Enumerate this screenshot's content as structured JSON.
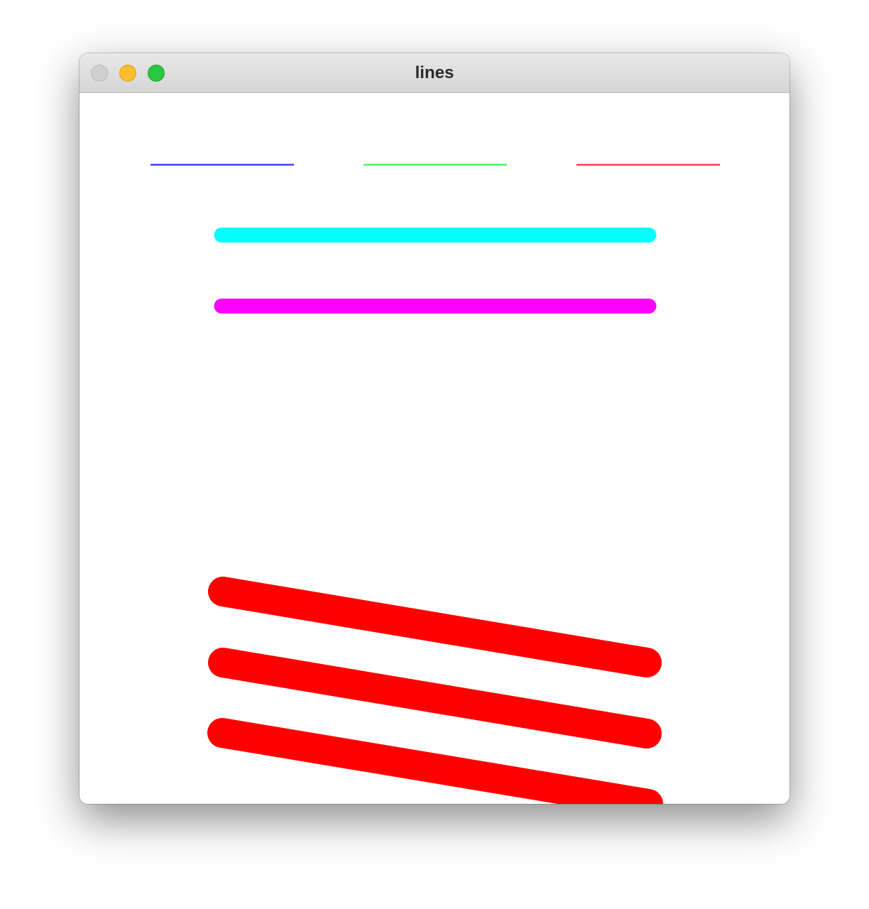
{
  "window": {
    "title": "lines"
  },
  "icons": {
    "close": "close-button",
    "minimize": "minimize-button",
    "zoom": "zoom-button"
  },
  "colors": {
    "close": "#d0d0d0",
    "minimize": "#febc2e",
    "zoom": "#28c840",
    "blue": "#4040ff",
    "green": "#40ff60",
    "red": "#ff4040",
    "cyan": "#00ffff",
    "magenta": "#ff00ff",
    "bright_red": "#ff0000"
  }
}
